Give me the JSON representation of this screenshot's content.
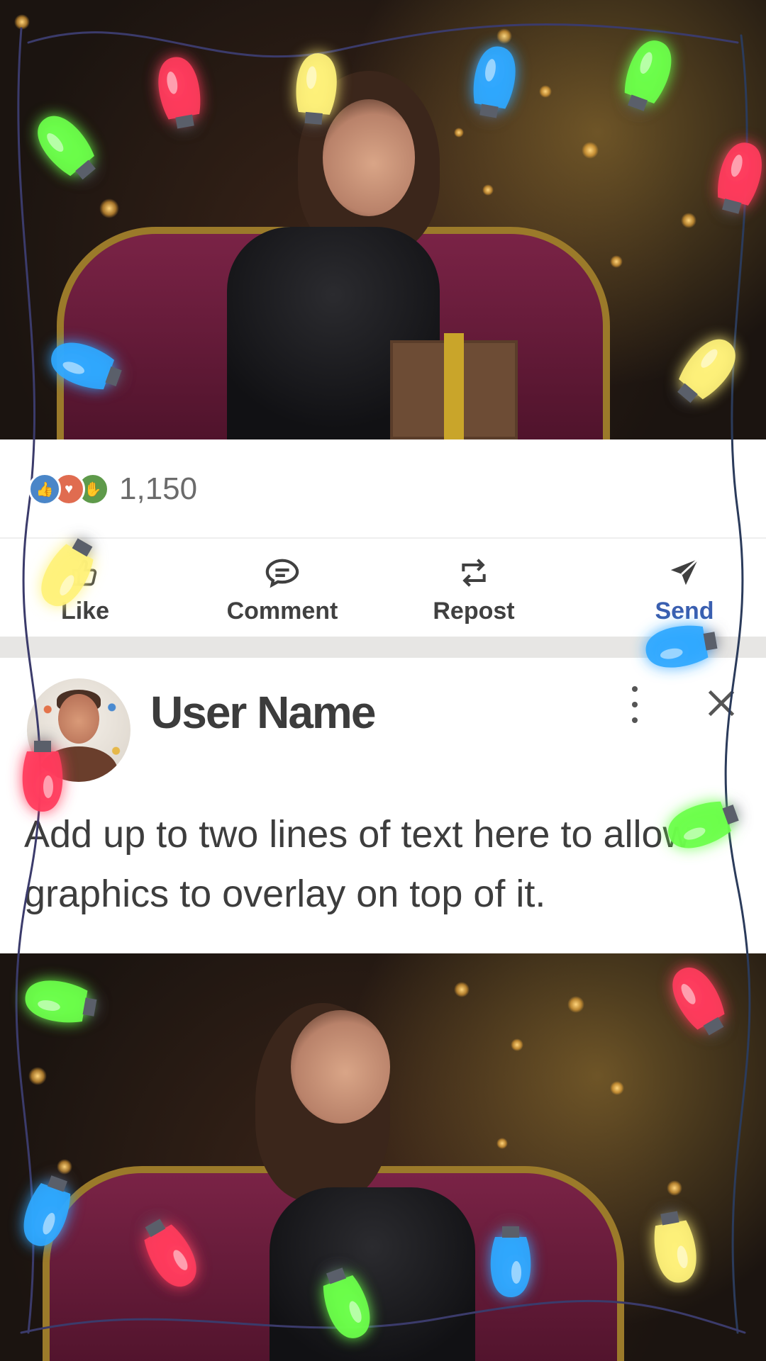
{
  "post": {
    "reactions": {
      "count": "1,150",
      "icons": [
        "like-icon",
        "love-icon",
        "clap-icon"
      ]
    },
    "actions": [
      {
        "label": "Like",
        "icon": "thumbs-up-icon"
      },
      {
        "label": "Comment",
        "icon": "comment-icon"
      },
      {
        "label": "Repost",
        "icon": "repost-icon"
      },
      {
        "label": "Send",
        "icon": "send-icon"
      }
    ],
    "author": {
      "name": "User Name"
    },
    "text": "Add up to two lines of text here to allow graphics to overlay on top of it."
  },
  "colors": {
    "send": "#3a5fb0",
    "action_label": "#404040",
    "divider": "#e7e6e4",
    "bulb_red": "#ff3b5c",
    "bulb_yellow": "#fff27a",
    "bulb_green": "#6bff4a",
    "bulb_blue": "#2fa8ff"
  }
}
